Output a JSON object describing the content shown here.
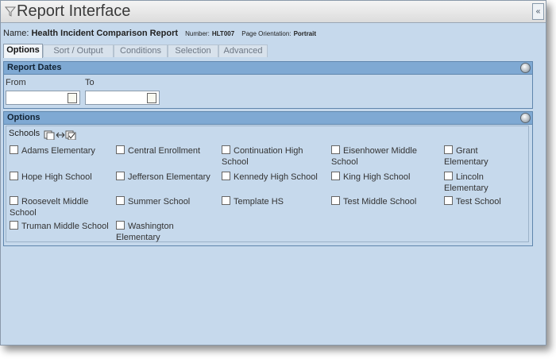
{
  "window": {
    "title": "Report Interface",
    "collapse_label": "«"
  },
  "report": {
    "name_label": "Name:",
    "name": "Health Incident Comparison Report",
    "number_label": "Number:",
    "number": "HLT007",
    "orientation_label": "Page Orientation:",
    "orientation": "Portrait"
  },
  "tabs": [
    "Options",
    "Sort / Output",
    "Conditions",
    "Selection",
    "Advanced"
  ],
  "report_dates": {
    "title": "Report Dates",
    "from_label": "From",
    "to_label": "To",
    "from_value": "",
    "to_value": ""
  },
  "options": {
    "title": "Options",
    "schools_label": "Schools",
    "schools": [
      [
        "Adams Elementary",
        "Central Enrollment",
        "Continuation High School",
        "Eisenhower Middle School",
        "Grant Elementary"
      ],
      [
        "Hope High School",
        "Jefferson Elementary",
        "Kennedy High School",
        "King High School",
        "Lincoln Elementary"
      ],
      [
        "Roosevelt Middle School",
        "Summer School",
        "Template HS",
        "Test Middle School",
        "Test School"
      ],
      [
        "Truman Middle School",
        "Washington Elementary"
      ]
    ]
  },
  "icons": {
    "filter": "filter-icon",
    "gear": "gear-icon",
    "calendar": "calendar-icon",
    "select_all": "select-all-icon"
  }
}
